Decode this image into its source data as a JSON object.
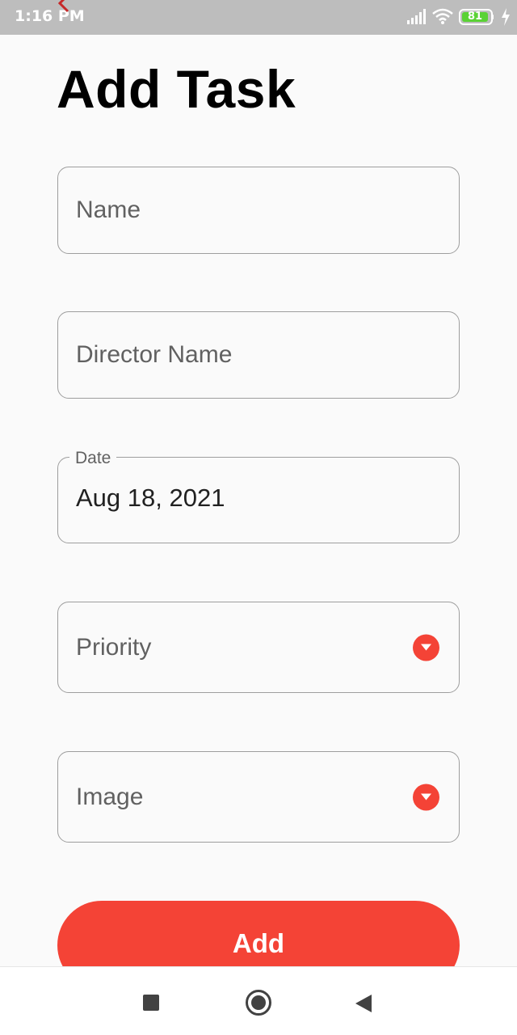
{
  "status_bar": {
    "time": "1:16 PM",
    "battery_level": "81",
    "icons": [
      "signal-icon",
      "wifi-icon",
      "battery-icon",
      "charging-icon"
    ]
  },
  "page": {
    "title": "Add Task"
  },
  "form": {
    "name_placeholder": "Name",
    "director_placeholder": "Director Name",
    "date_label": "Date",
    "date_value": "Aug 18, 2021",
    "priority_placeholder": "Priority",
    "image_placeholder": "Image"
  },
  "actions": {
    "add_label": "Add"
  },
  "colors": {
    "accent": "#f44336",
    "background": "#fafafa",
    "status_bar": "#bdbdbd",
    "border": "#9e9e9e"
  }
}
